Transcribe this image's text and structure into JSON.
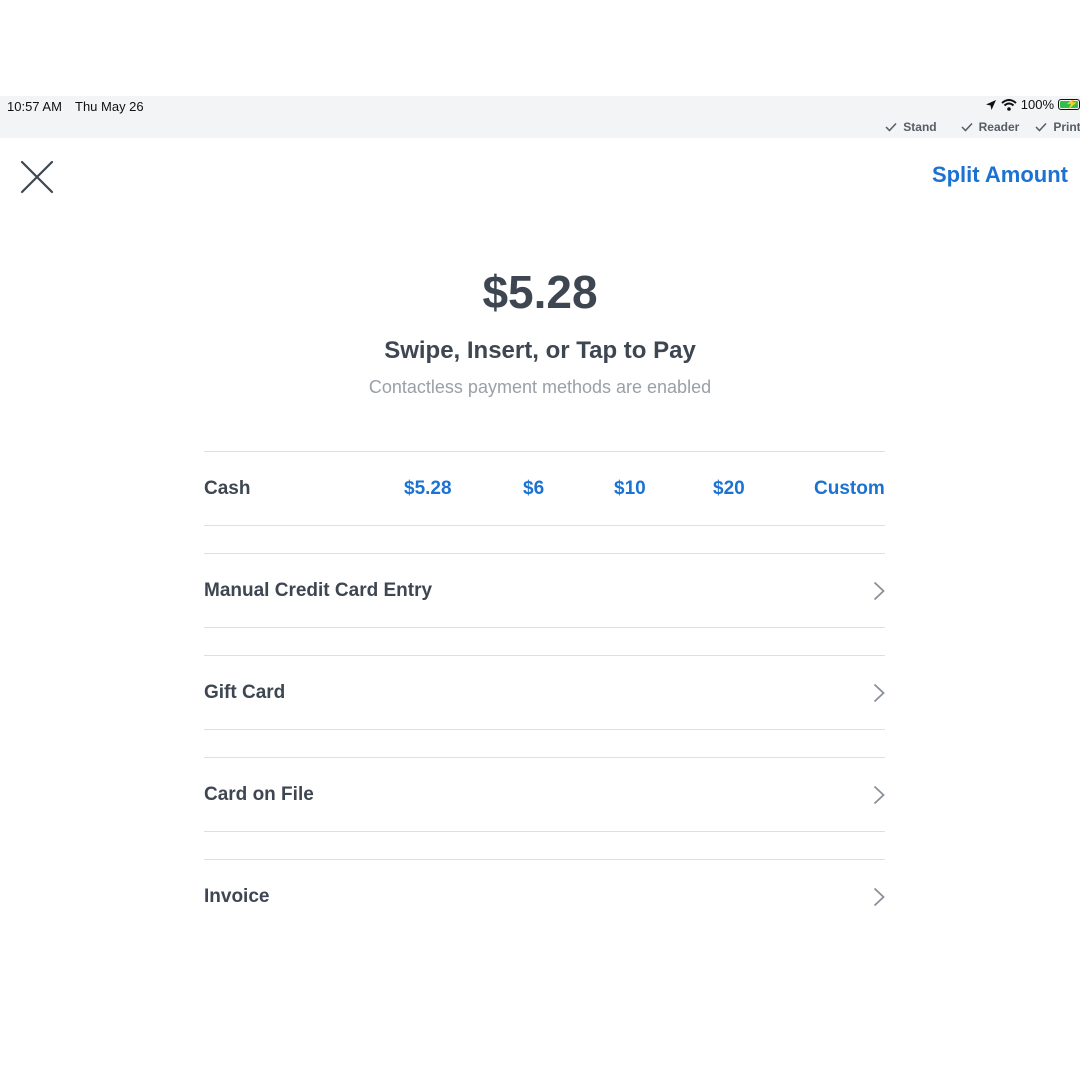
{
  "status_bar": {
    "time": "10:57 AM",
    "date": "Thu May 26",
    "battery_percent": "100%",
    "battery_level": 1.0,
    "devices": [
      "Stand",
      "Reader",
      "Printer"
    ]
  },
  "header": {
    "close_icon": "close-icon",
    "split_label": "Split Amount"
  },
  "payment": {
    "amount": "$5.28",
    "headline": "Swipe, Insert, or Tap to Pay",
    "subline": "Contactless payment methods are enabled"
  },
  "cash": {
    "label": "Cash",
    "options": [
      "$5.28",
      "$6",
      "$10",
      "$20",
      "Custom"
    ]
  },
  "methods": [
    {
      "label": "Manual Credit Card Entry"
    },
    {
      "label": "Gift Card"
    },
    {
      "label": "Card on File"
    },
    {
      "label": "Invoice"
    }
  ],
  "colors": {
    "accent": "#1c72d2",
    "text": "#3d4651",
    "muted": "#9aa0a6",
    "status_bar_bg": "#f3f4f6",
    "battery": "#30c048"
  }
}
